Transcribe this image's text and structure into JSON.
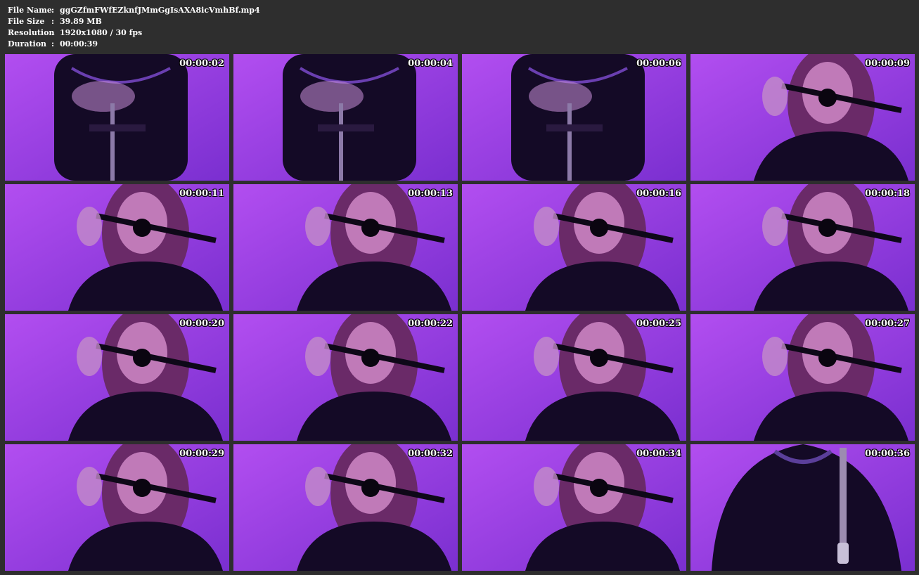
{
  "file_info": {
    "name_label": "File Name",
    "name_value": "ggGZfmFWfEZknfJMmGgIsAXA8icVmhBf.mp4",
    "size_label": "File Size",
    "size_value": "39.89 MB",
    "resolution_label": "Resolution",
    "resolution_value": "1920x1080 / 30 fps",
    "duration_label": "Duration",
    "duration_value": "00:00:39",
    "separator": ":"
  },
  "colors": {
    "background": "#2e2e2e",
    "text": "#ffffff",
    "thumb_light": "#b24ef0",
    "thumb_dark": "#140a26"
  },
  "thumbnails": [
    {
      "timestamp": "00:00:02",
      "scene": "torso"
    },
    {
      "timestamp": "00:00:04",
      "scene": "torso"
    },
    {
      "timestamp": "00:00:06",
      "scene": "torso"
    },
    {
      "timestamp": "00:00:09",
      "scene": "portrait"
    },
    {
      "timestamp": "00:00:11",
      "scene": "portrait"
    },
    {
      "timestamp": "00:00:13",
      "scene": "portrait"
    },
    {
      "timestamp": "00:00:16",
      "scene": "portrait"
    },
    {
      "timestamp": "00:00:18",
      "scene": "portrait"
    },
    {
      "timestamp": "00:00:20",
      "scene": "portrait"
    },
    {
      "timestamp": "00:00:22",
      "scene": "portrait"
    },
    {
      "timestamp": "00:00:25",
      "scene": "portrait"
    },
    {
      "timestamp": "00:00:27",
      "scene": "portrait"
    },
    {
      "timestamp": "00:00:29",
      "scene": "portrait"
    },
    {
      "timestamp": "00:00:32",
      "scene": "portrait"
    },
    {
      "timestamp": "00:00:34",
      "scene": "portrait"
    },
    {
      "timestamp": "00:00:36",
      "scene": "closeup"
    }
  ]
}
